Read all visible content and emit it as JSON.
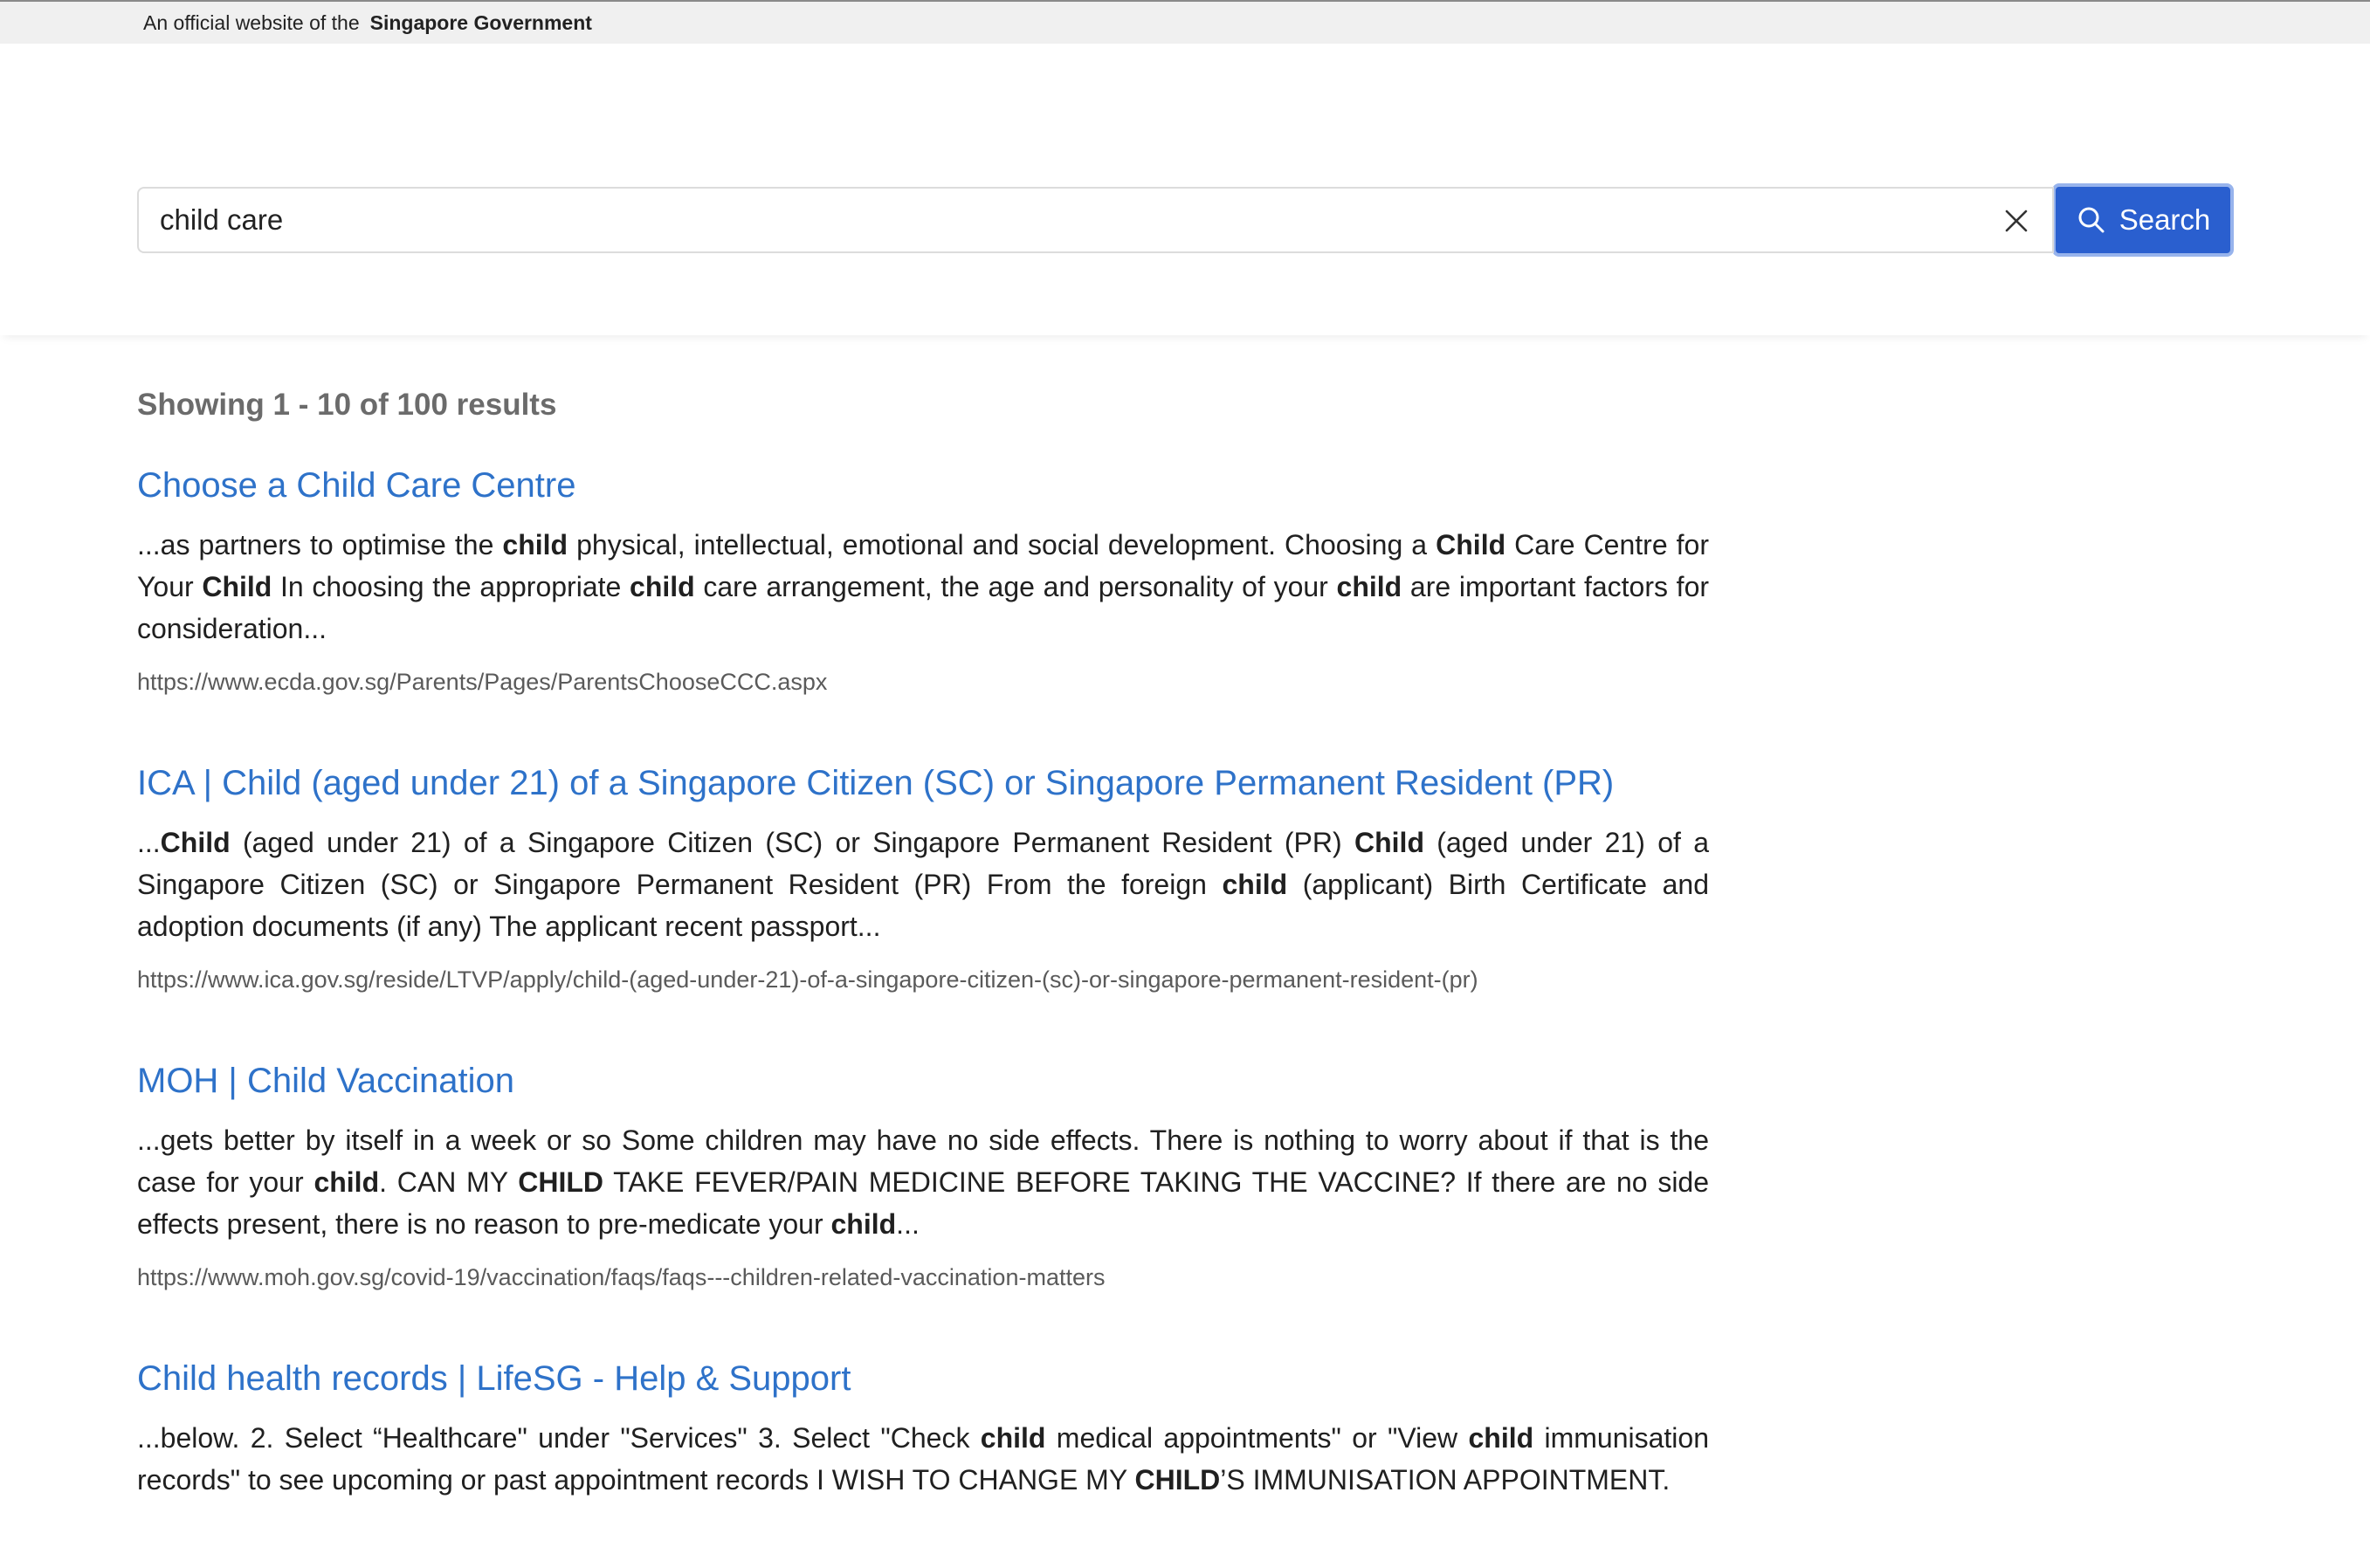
{
  "masthead": {
    "prefix": "An official website of the",
    "government": "Singapore Government"
  },
  "search": {
    "query": "child care",
    "button_label": "Search"
  },
  "results_summary": "Showing 1 - 10 of 100 results",
  "results": [
    {
      "title": "Choose a Child Care Centre",
      "snippet": [
        {
          "t": "...as partners to optimise the "
        },
        {
          "t": "child",
          "b": true
        },
        {
          "t": " physical, intellectual, emotional and social development. Choosing a "
        },
        {
          "t": "Child",
          "b": true
        },
        {
          "t": " Care Centre for Your "
        },
        {
          "t": "Child",
          "b": true
        },
        {
          "t": " In choosing the appropriate "
        },
        {
          "t": "child",
          "b": true
        },
        {
          "t": " care arrangement, the age and personality of your "
        },
        {
          "t": "child",
          "b": true
        },
        {
          "t": " are important factors for consideration..."
        }
      ],
      "url": "https://www.ecda.gov.sg/Parents/Pages/ParentsChooseCCC.aspx"
    },
    {
      "title": "ICA | Child (aged under 21) of a Singapore Citizen (SC) or Singapore Permanent Resident (PR)",
      "snippet": [
        {
          "t": "..."
        },
        {
          "t": "Child",
          "b": true
        },
        {
          "t": " (aged under 21) of a Singapore Citizen (SC) or Singapore Permanent Resident (PR) "
        },
        {
          "t": "Child",
          "b": true
        },
        {
          "t": " (aged under 21) of a Singapore Citizen (SC) or Singapore Permanent Resident (PR) From the foreign "
        },
        {
          "t": "child",
          "b": true
        },
        {
          "t": " (applicant) Birth Certificate and adoption documents (if any) The applicant recent passport..."
        }
      ],
      "url": "https://www.ica.gov.sg/reside/LTVP/apply/child-(aged-under-21)-of-a-singapore-citizen-(sc)-or-singapore-permanent-resident-(pr)"
    },
    {
      "title": "MOH | Child Vaccination",
      "snippet": [
        {
          "t": "...gets better by itself in a week or so Some children may have no side effects. There is nothing to worry about if that is the case for your "
        },
        {
          "t": "child",
          "b": true
        },
        {
          "t": ". CAN MY "
        },
        {
          "t": "CHILD",
          "b": true
        },
        {
          "t": " TAKE FEVER/PAIN MEDICINE BEFORE TAKING THE VACCINE? If there are no side effects present, there is no reason to pre-medicate your "
        },
        {
          "t": "child",
          "b": true
        },
        {
          "t": "..."
        }
      ],
      "url": "https://www.moh.gov.sg/covid-19/vaccination/faqs/faqs---children-related-vaccination-matters"
    },
    {
      "title": "Child health records | LifeSG - Help & Support",
      "snippet": [
        {
          "t": "...below. 2. Select “Healthcare\" under \"Services\" 3. Select \"Check "
        },
        {
          "t": "child",
          "b": true
        },
        {
          "t": " medical appointments\" or \"View "
        },
        {
          "t": "child",
          "b": true
        },
        {
          "t": " immunisation records\" to see upcoming or past appointment records I WISH TO CHANGE MY "
        },
        {
          "t": "CHILD",
          "b": true
        },
        {
          "t": "’S IMMUNISATION APPOINTMENT."
        }
      ],
      "url": ""
    }
  ]
}
